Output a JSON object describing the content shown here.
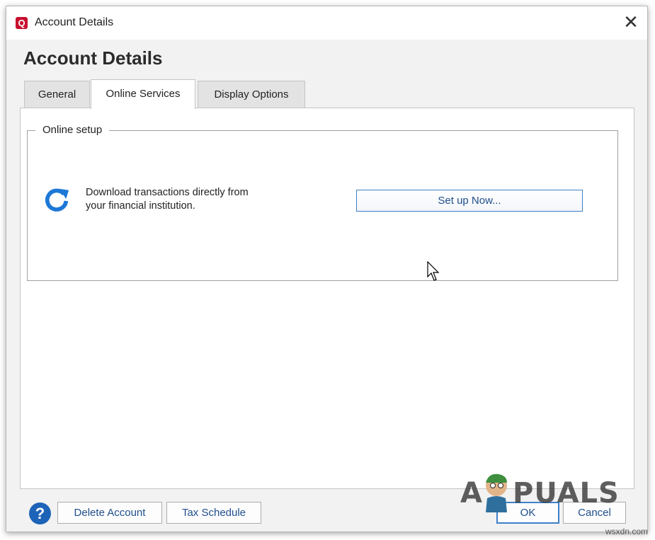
{
  "window": {
    "title": "Account Details",
    "app_logo_letter": "Q",
    "close_glyph": "✕"
  },
  "page": {
    "heading": "Account Details"
  },
  "tabs": [
    {
      "label": "General",
      "active": false
    },
    {
      "label": "Online Services",
      "active": true
    },
    {
      "label": "Display Options",
      "active": false
    }
  ],
  "online_setup": {
    "legend": "Online setup",
    "icon": "refresh-icon",
    "description": "Download transactions directly from your financial institution.",
    "button_label": "Set up Now..."
  },
  "footer": {
    "help_glyph": "?",
    "delete_label": "Delete Account",
    "tax_label": "Tax Schedule",
    "ok_label": "OK",
    "cancel_label": "Cancel"
  },
  "watermark": {
    "text": "PUALS",
    "leading_letter": "A",
    "site": "wsxdn.com"
  },
  "colors": {
    "brand_red": "#c8102e",
    "accent_blue": "#1d64b8",
    "button_border": "#3f7fc8"
  }
}
